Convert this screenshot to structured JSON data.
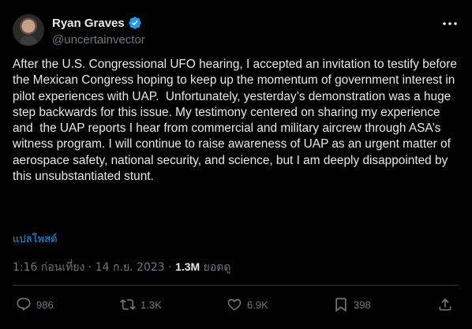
{
  "author": {
    "name": "Ryan Graves",
    "handle": "@uncertainvector"
  },
  "tweet": {
    "text": "After the U.S. Congressional UFO hearing, I accepted an invitation to testify before the Mexican Congress hoping to keep up the momentum of government interest in pilot experiences with UAP.  Unfortunately, yesterday’s demonstration was a huge step backwards for this issue. My testimony centered on sharing my experience and  the UAP reports I hear from commercial and military aircrew through ASA’s witness program. I will continue to raise awareness of UAP as an urgent matter of aerospace safety, national security, and science, but I am deeply disappointed by this unsubstantiated stunt.",
    "translate_label": "แปลโพสต์"
  },
  "meta": {
    "time": "1:16 ก่อนเที่ยง",
    "separator": " · ",
    "date": "14 ก.ย. 2023",
    "views_count": "1.3M",
    "views_label": " ยอดดู"
  },
  "actions": {
    "replies": "986",
    "reposts": "1.3K",
    "likes": "6.9K",
    "bookmarks": "398"
  },
  "colors": {
    "background": "#000000",
    "text": "#e7e9ea",
    "muted": "#71767b",
    "accent": "#1d9bf0",
    "divider": "#2f3336"
  },
  "icons": [
    "verified-badge-icon",
    "more-icon",
    "reply-icon",
    "repost-icon",
    "like-icon",
    "bookmark-icon",
    "share-icon"
  ]
}
